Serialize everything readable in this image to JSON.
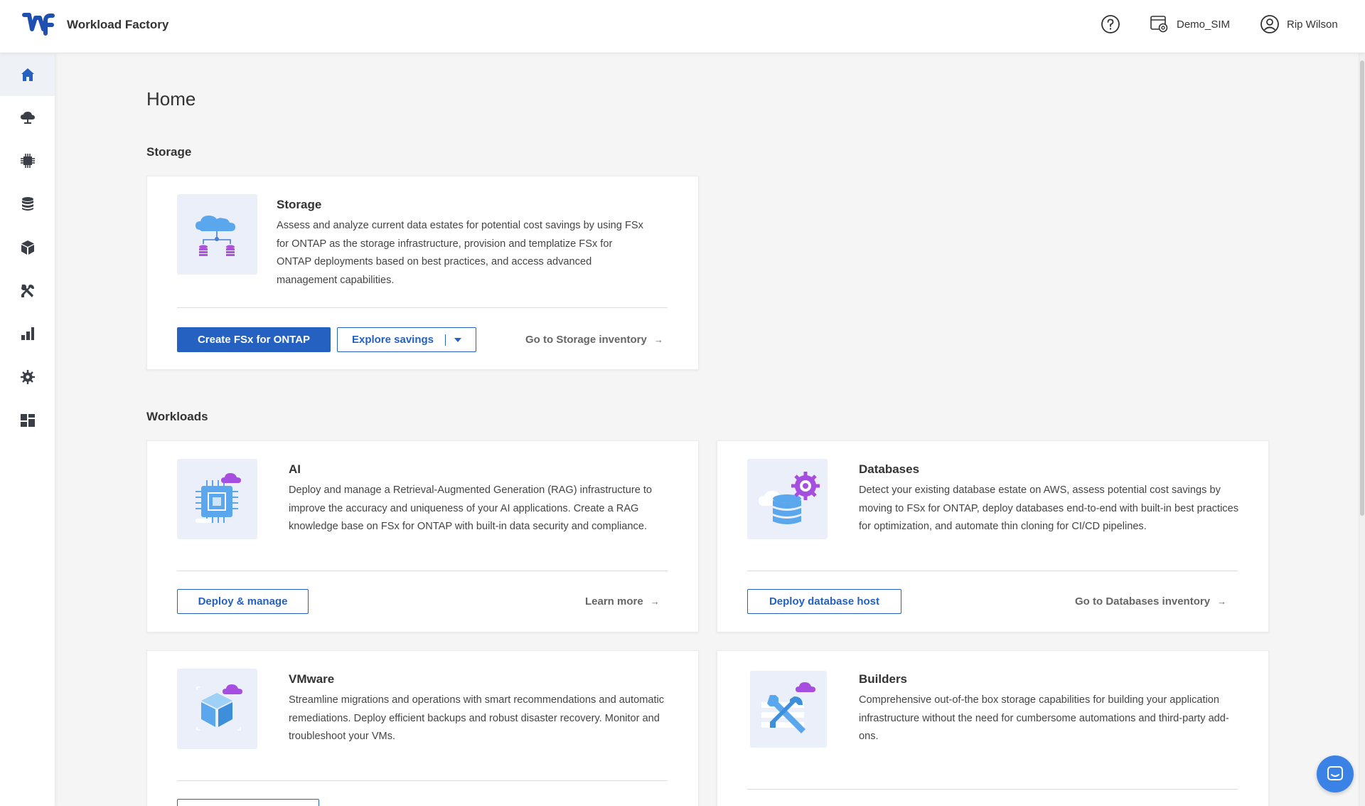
{
  "app": {
    "title": "Workload Factory"
  },
  "topbar": {
    "account": "Demo_SIM",
    "user": "Rip Wilson"
  },
  "sidebar": {
    "items": [
      {
        "icon": "home-icon",
        "active": true
      },
      {
        "icon": "cloud-storage-icon"
      },
      {
        "icon": "chip-icon"
      },
      {
        "icon": "database-icon"
      },
      {
        "icon": "cube-icon"
      },
      {
        "icon": "tools-icon"
      },
      {
        "icon": "bar-chart-icon"
      },
      {
        "icon": "gear-network-icon"
      },
      {
        "icon": "dashboard-icon"
      }
    ]
  },
  "page": {
    "title": "Home"
  },
  "sections": {
    "storage": "Storage",
    "workloads": "Workloads"
  },
  "cards": {
    "storage": {
      "title": "Storage",
      "description": "Assess and analyze current data estates for potential cost savings by using FSx for ONTAP as the storage infrastructure, provision and templatize FSx for ONTAP deployments based on best practices, and access advanced management capabilities.",
      "primary_button": "Create FSx for ONTAP",
      "secondary_button": "Explore savings",
      "link": "Go to Storage inventory"
    },
    "ai": {
      "title": "AI",
      "description": "Deploy and manage a Retrieval-Augmented Generation (RAG) infrastructure to improve the accuracy and uniqueness of your AI applications. Create a RAG knowledge base on FSx for ONTAP with built-in data security and compliance.",
      "button": "Deploy & manage",
      "link": "Learn more"
    },
    "databases": {
      "title": "Databases",
      "description": "Detect your existing database estate on AWS, assess potential cost savings by moving to FSx for ONTAP, deploy databases end-to-end with built-in best practices for optimization, and automate thin cloning for CI/CD pipelines.",
      "button": "Deploy database host",
      "link": "Go to Databases inventory"
    },
    "vmware": {
      "title": "VMware",
      "description": "Streamline migrations and operations with smart recommendations and automatic remediations. Deploy efficient backups and robust disaster recovery. Monitor and troubleshoot your VMs."
    },
    "builders": {
      "title": "Builders",
      "description": "Comprehensive out-of-the box storage capabilities for building your application infrastructure without the need for cumbersome automations and third-party add-ons."
    }
  },
  "colors": {
    "accent": "#2461c1",
    "nav_icon": "#3a3f47",
    "illustration_blue": "#5aa7ee",
    "illustration_purple": "#a64ee0"
  }
}
